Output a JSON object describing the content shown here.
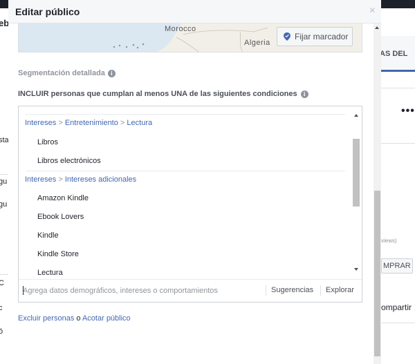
{
  "background": {
    "left_fragments": [
      "eb",
      "sta",
      "gu",
      "gu",
      "C",
      "c",
      "ó"
    ],
    "right_fragments": {
      "tab_label": "AS DEL",
      "more": "•••",
      "reviews": "views)",
      "buy_label": "MPRAR",
      "share_label": "ompartir"
    }
  },
  "modal": {
    "title": "Editar público",
    "close": "×"
  },
  "map": {
    "labels": [
      "Morocco",
      "Algeria"
    ],
    "pin_button": "Fijar marcador"
  },
  "segmentation": {
    "title": "Segmentación detallada",
    "include_title": "INCLUIR personas que cumplan al menos UNA de las siguientes condiciones",
    "groups": [
      {
        "crumb": [
          "Intereses",
          "Entretenimiento",
          "Lectura"
        ],
        "items": [
          "Libros",
          "Libros electrónicos"
        ]
      },
      {
        "crumb": [
          "Intereses",
          "Intereses adicionales"
        ],
        "items": [
          "Amazon Kindle",
          "Ebook Lovers",
          "Kindle",
          "Kindle Store",
          "Lectura"
        ]
      }
    ],
    "crumb_separator": ">"
  },
  "search": {
    "placeholder": "Agrega datos demográficos, intereses o comportamientos",
    "suggestions": "Sugerencias",
    "explore": "Explorar"
  },
  "footer": {
    "exclude": "Excluir personas",
    "conj": "o",
    "narrow": "Acotar público"
  }
}
